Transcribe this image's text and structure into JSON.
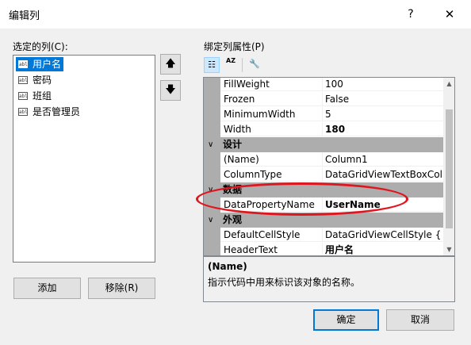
{
  "window": {
    "title": "编辑列",
    "help_label": "?",
    "close_label": "✕"
  },
  "left": {
    "label": "选定的列(C):",
    "columns": [
      {
        "label": "用户名",
        "selected": true,
        "icon": "abl"
      },
      {
        "label": "密码",
        "selected": false,
        "icon": "abl"
      },
      {
        "label": "班组",
        "selected": false,
        "icon": "abl"
      },
      {
        "label": "是否管理员",
        "selected": false,
        "icon": "abl"
      }
    ],
    "move_up_icon": "🡅",
    "move_down_icon": "🡇",
    "add_label": "添加",
    "remove_label": "移除(R)"
  },
  "right": {
    "label": "绑定列属性(P)",
    "toolbar": {
      "categorized_icon": "categorized-icon",
      "alpha_icon": "alphabetical-sort-icon",
      "pages_icon": "property-pages-icon",
      "categorized_glyph": "☷",
      "alpha_glyph": "AZ",
      "pages_glyph": "🔧"
    },
    "grid": {
      "rows": [
        {
          "type": "prop",
          "name": "FillWeight",
          "value": "100",
          "bold": false
        },
        {
          "type": "prop",
          "name": "Frozen",
          "value": "False",
          "bold": false
        },
        {
          "type": "prop",
          "name": "MinimumWidth",
          "value": "5",
          "bold": false
        },
        {
          "type": "prop",
          "name": "Width",
          "value": "180",
          "bold": true
        },
        {
          "type": "cat",
          "name": "设计",
          "chevron": "∨"
        },
        {
          "type": "prop",
          "name": "(Name)",
          "value": "Column1",
          "bold": false
        },
        {
          "type": "prop",
          "name": "ColumnType",
          "value": "DataGridViewTextBoxColumn",
          "bold": false
        },
        {
          "type": "cat",
          "name": "数据",
          "chevron": "∨"
        },
        {
          "type": "prop",
          "name": "DataPropertyName",
          "value": "UserName",
          "bold": true
        },
        {
          "type": "cat",
          "name": "外观",
          "chevron": "∨"
        },
        {
          "type": "prop",
          "name": "DefaultCellStyle",
          "value": "DataGridViewCellStyle { }",
          "bold": false
        },
        {
          "type": "prop",
          "name": "HeaderText",
          "value": "用户名",
          "bold": true
        }
      ]
    },
    "description": {
      "title": "(Name)",
      "text": "指示代码中用来标识该对象的名称。"
    }
  },
  "buttons": {
    "ok_label": "确定",
    "cancel_label": "取消"
  },
  "colors": {
    "selection": "#0078d7",
    "highlight_oval": "#e0161f",
    "category_bg": "#adadad"
  }
}
